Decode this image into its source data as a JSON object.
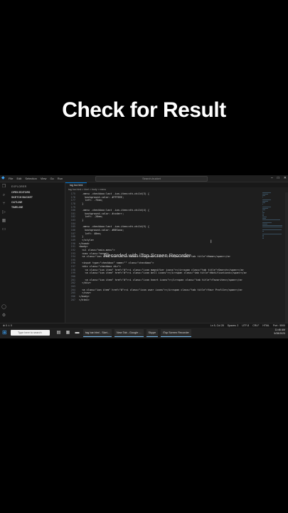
{
  "headline": "Check for Result",
  "titlebar": {
    "menu": [
      "File",
      "Edit",
      "Selection",
      "View",
      "Go",
      "Run"
    ],
    "search_placeholder": "Search-bucket"
  },
  "sidebar": {
    "header": "EXPLORER",
    "sections": [
      "OPEN EDITORS",
      "SKETCH BUCKET",
      "OUTLINE",
      "TIMELINE"
    ]
  },
  "editor": {
    "tab": "tag bar.html",
    "breadcrumb": "tag bar.html > html > body > menu",
    "lines": [
      {
        "no": "175",
        "text": "  .menu .checkbox:last .ion-item:nth-child(3) {"
      },
      {
        "no": "176",
        "text": "    background-color: #FFFEEE;"
      },
      {
        "no": "177",
        "text": "    left: -75em;"
      },
      {
        "no": "178",
        "text": "  }"
      },
      {
        "no": "179",
        "text": ""
      },
      {
        "no": "180",
        "text": "  .menu .checkbox:last .ion-item:nth-child(4) {"
      },
      {
        "no": "181",
        "text": "    background-color: #ccderr;"
      },
      {
        "no": "182",
        "text": "    left: -20em;"
      },
      {
        "no": "183",
        "text": "  }"
      },
      {
        "no": "184",
        "text": ""
      },
      {
        "no": "185",
        "text": "  .menu .checkbox:last .ion-item:nth-child(5) {"
      },
      {
        "no": "186",
        "text": "    background-color: #BESana;"
      },
      {
        "no": "187",
        "text": "    left: 40em;"
      },
      {
        "no": "188",
        "text": "  }"
      },
      {
        "no": "189",
        "text": "  </style>"
      },
      {
        "no": "190",
        "text": "</head>"
      },
      {
        "no": "191",
        "text": "<body>"
      },
      {
        "no": "192",
        "text": "  <ul class=\"main-menu\">"
      },
      {
        "no": "193",
        "text": "  <nav class=\"menu\">"
      },
      {
        "no": "194",
        "text": "  <a class=\"ion item\" href=\"#\"><i class=\"icon home icons\"></i><span class=\"tab title\">Home</span></a>"
      },
      {
        "no": "195",
        "text": ""
      },
      {
        "no": "196",
        "text": "  <input type=\"checkbox\" name=\"\" class=\"checkbox\">"
      },
      {
        "no": "197",
        "text": "  <div class=\"checkbox div\">"
      },
      {
        "no": "198",
        "text": "    <a class=\"ion item\" href=\"#\"><i class=\"icon magnifier icons\"></i><span class=\"tab title\">Search</span></a>"
      },
      {
        "no": "199",
        "text": "    <a class=\"ion item\" href=\"#\"><i class=\"icon bell icons\"></i><span class=\"tab title\">Notifications</span></a>"
      },
      {
        "no": "200",
        "text": ""
      },
      {
        "no": "201",
        "text": "    <a class=\"ion item\" href=\"#\"><i class=\"icon heart icons\"></i><span class=\"tab title\">Favorites</span></a>"
      },
      {
        "no": "202",
        "text": "  </div>"
      },
      {
        "no": "203",
        "text": ""
      },
      {
        "no": "204",
        "text": "  <a class=\"ion item\" href=\"#\"><i class=\"icon user icons\"></i><span class=\"tab title\">Your Profile</span></a>"
      },
      {
        "no": "205",
        "text": "  </nav>"
      },
      {
        "no": "206",
        "text": "</body>"
      },
      {
        "no": "207",
        "text": "</html>"
      }
    ]
  },
  "watermark": "Recorded with iTop Screen Recorder",
  "statusbar": {
    "left": "⊗ 0 ⚠ 0",
    "right": [
      "Ln 5, Col 28",
      "Spaces: 2",
      "UTF-8",
      "CRLF",
      "HTML",
      "Port : 5500"
    ]
  },
  "taskbar": {
    "search": "Type here to search",
    "items": [
      "tag bar.html - Sket...",
      "New Tab - Google ...",
      "Skype",
      "iTop Screen Recorder"
    ],
    "time": "11:46 AM",
    "date": "5/28/2023"
  },
  "colors": {
    "accent": "#0078d4",
    "background": "#000000",
    "editor_bg": "#1e1e1e"
  }
}
